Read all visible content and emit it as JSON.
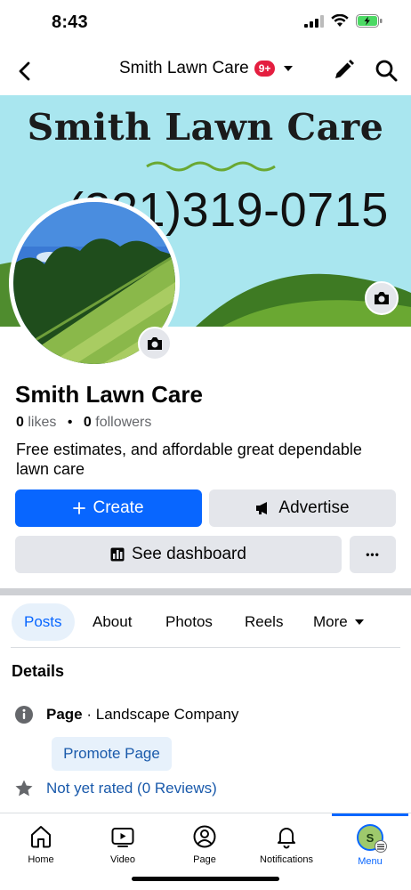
{
  "status": {
    "time": "8:43",
    "battery_color": "#4cd964"
  },
  "header": {
    "title": "Smith Lawn Care",
    "badge": "9+"
  },
  "cover": {
    "title": "Smith Lawn Care",
    "phone": "(321)319-0715"
  },
  "profile": {
    "name": "Smith Lawn Care",
    "likes_count": "0",
    "likes_label": "likes",
    "followers_count": "0",
    "followers_label": "followers",
    "bio": "Free estimates, and affordable great dependable lawn care"
  },
  "actions": {
    "create": "Create",
    "advertise": "Advertise",
    "dashboard": "See dashboard",
    "more": "•••"
  },
  "tabs": [
    {
      "label": "Posts",
      "active": true
    },
    {
      "label": "About"
    },
    {
      "label": "Photos"
    },
    {
      "label": "Reels"
    },
    {
      "label": "More"
    }
  ],
  "details": {
    "heading": "Details",
    "page_label": "Page",
    "page_category": " · Landscape Company",
    "promote": "Promote Page",
    "rating": "Not yet rated (0 Reviews)"
  },
  "bottom_nav": [
    {
      "label": "Home",
      "icon": "home-icon"
    },
    {
      "label": "Video",
      "icon": "video-icon"
    },
    {
      "label": "Page",
      "icon": "page-icon"
    },
    {
      "label": "Notifications",
      "icon": "bell-icon"
    },
    {
      "label": "Menu",
      "icon": "menu-avatar",
      "active": true,
      "avatar_letter": "S"
    }
  ],
  "colors": {
    "accent": "#0866ff",
    "badge": "#e41e3f",
    "cover_sky": "#a9e6ef",
    "hill": "#4f8c2e"
  }
}
